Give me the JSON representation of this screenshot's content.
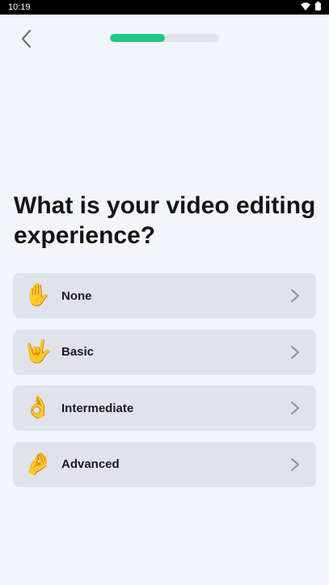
{
  "status_bar": {
    "time": "10:19",
    "icons": [
      "wifi-icon",
      "battery-icon"
    ]
  },
  "header": {
    "back_icon": "chevron-left-icon",
    "progress": 0.5
  },
  "question": "What is your video editing experience?",
  "options": [
    {
      "label": "None",
      "emoji": "✋",
      "icon": "raised-hand-icon"
    },
    {
      "label": "Basic",
      "emoji": "🤟",
      "icon": "love-you-gesture-icon"
    },
    {
      "label": "Intermediate",
      "emoji": "👌",
      "icon": "ok-hand-icon"
    },
    {
      "label": "Advanced",
      "emoji": "🤌",
      "icon": "pinched-fingers-icon"
    }
  ],
  "colors": {
    "accent": "#23c787",
    "background": "#f4f5fa",
    "option_bg": "#e1e2ea"
  }
}
